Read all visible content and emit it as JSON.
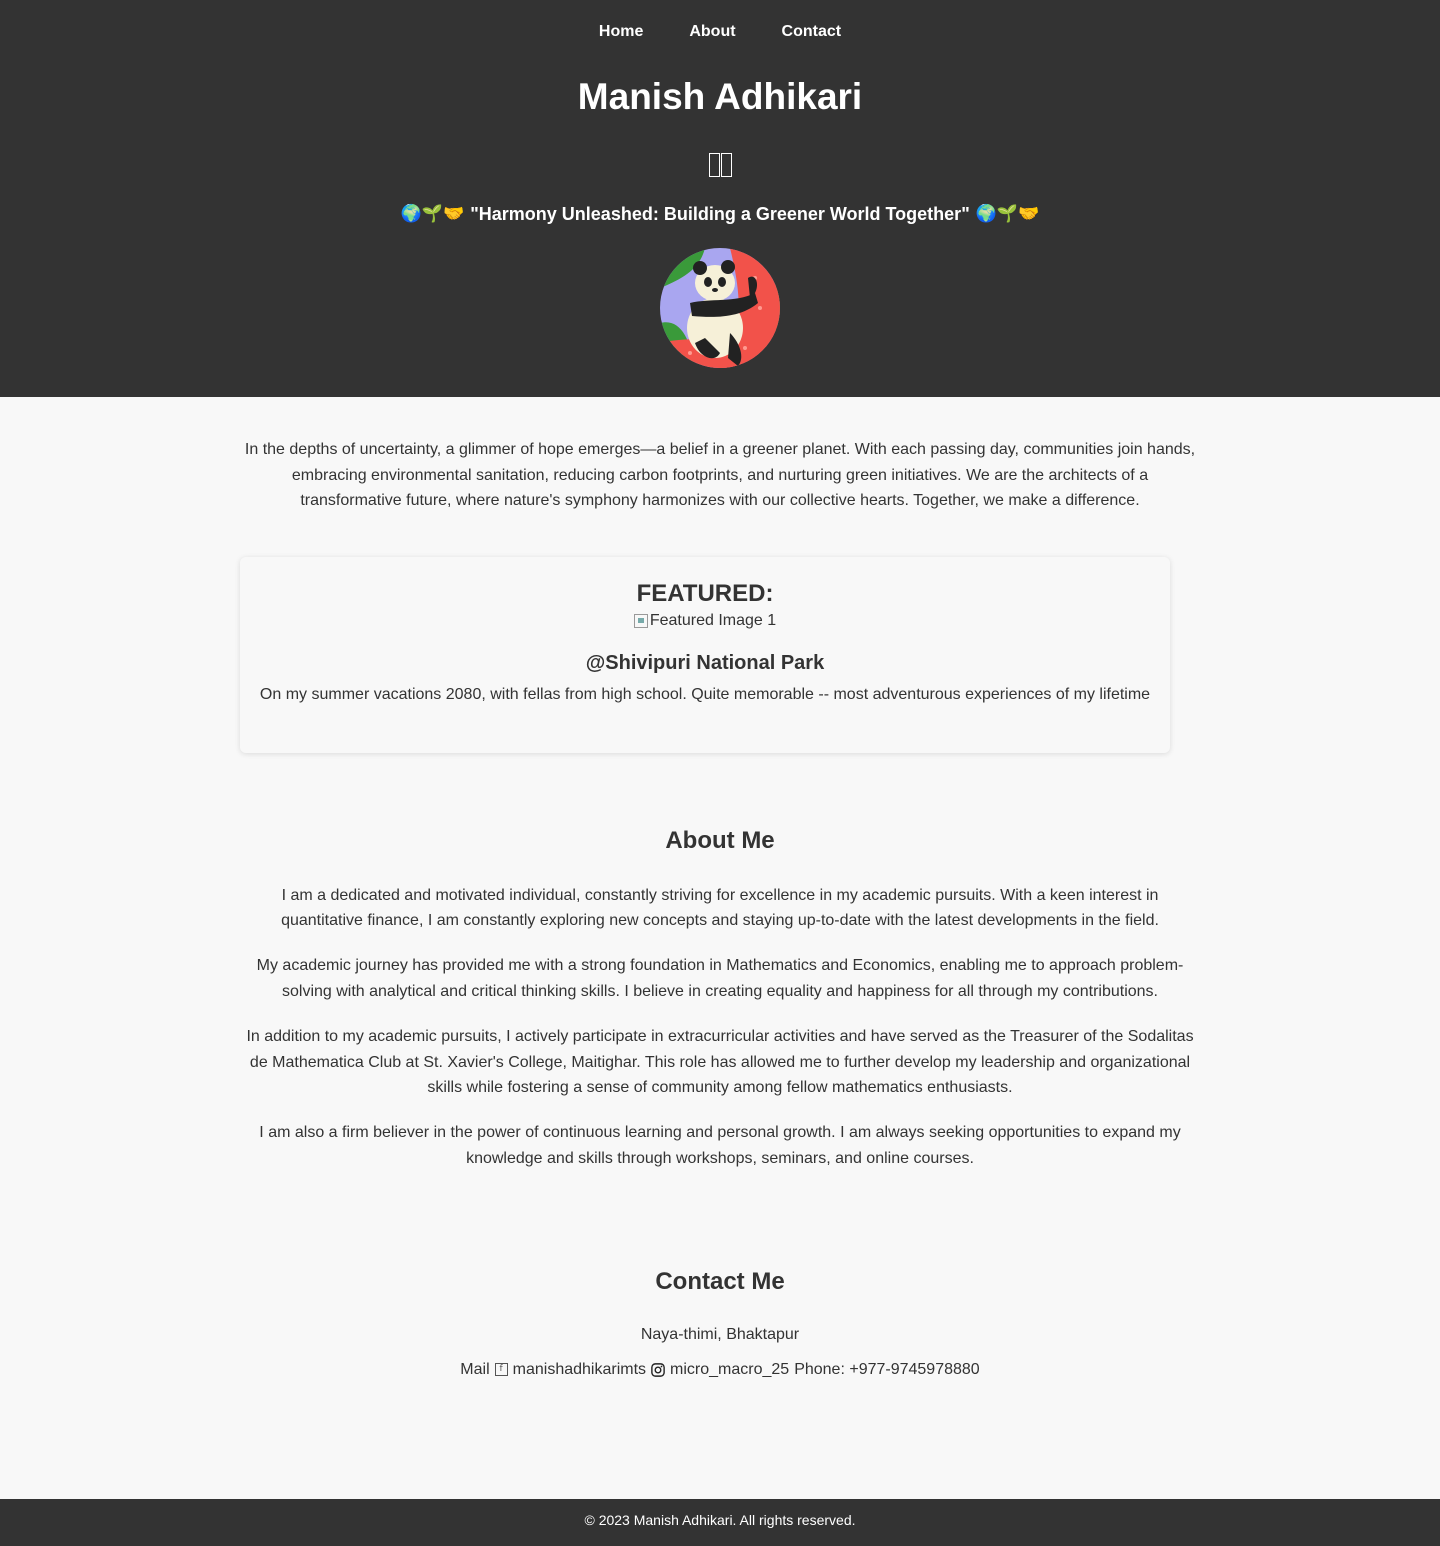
{
  "nav": {
    "items": [
      {
        "label": "Home"
      },
      {
        "label": "About"
      },
      {
        "label": "Contact"
      }
    ]
  },
  "header": {
    "title": "Manish Adhikari",
    "tagline": "\"Harmony Unleashed: Building a Greener World Together\"",
    "tagline_emoji_left": "🌍🌱🤝",
    "tagline_emoji_right": "🌍🌱🤝"
  },
  "intro": {
    "text": "In the depths of uncertainty, a glimmer of hope emerges—a belief in a greener planet. With each passing day, communities join hands, embracing environmental sanitation, reducing carbon footprints, and nurturing green initiatives. We are the architects of a transformative future, where nature's symphony harmonizes with our collective hearts. Together, we make a difference."
  },
  "featured": {
    "heading": "FEATURED:",
    "image_alt": "Featured Image 1",
    "title": "@Shivipuri National Park",
    "caption": "On my summer vacations 2080, with fellas from high school. Quite memorable -- most adventurous experiences of my lifetime"
  },
  "about": {
    "heading": "About Me",
    "paragraphs": [
      "I am a dedicated and motivated individual, constantly striving for excellence in my academic pursuits. With a keen interest in quantitative finance, I am constantly exploring new concepts and staying up-to-date with the latest developments in the field.",
      "My academic journey has provided me with a strong foundation in Mathematics and Economics, enabling me to approach problem-solving with analytical and critical thinking skills. I believe in creating equality and happiness for all through my contributions.",
      "In addition to my academic pursuits, I actively participate in extracurricular activities and have served as the Treasurer of the Sodalitas de Mathematica Club at St. Xavier's College, Maitighar. This role has allowed me to further develop my leadership and organizational skills while fostering a sense of community among fellow mathematics enthusiasts.",
      "I am also a firm believer in the power of continuous learning and personal growth. I am always seeking opportunities to expand my knowledge and skills through workshops, seminars, and online courses."
    ]
  },
  "contact": {
    "heading": "Contact Me",
    "address": "Naya-thimi, Bhaktapur",
    "mail_label": "Mail",
    "facebook": "manishadhikarimts",
    "instagram": "micro_macro_25",
    "phone": "Phone: +977-9745978880"
  },
  "footer": {
    "text": "© 2023 Manish Adhikari. All rights reserved."
  },
  "icons": {
    "header_glyph": "missing-glyph-icon",
    "facebook": "facebook-icon",
    "instagram": "instagram-icon",
    "broken_image": "broken-image-icon"
  },
  "colors": {
    "header_bg": "#333333",
    "page_bg": "#f8f8f8",
    "text": "#333333"
  }
}
